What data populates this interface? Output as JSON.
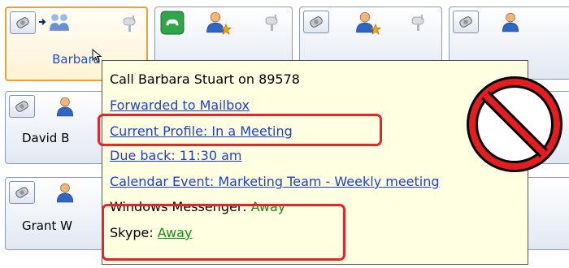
{
  "contacts": [
    {
      "name": "Barbara",
      "selected": true
    },
    {
      "name": "David B"
    },
    {
      "name": "Grant W"
    }
  ],
  "tooltip": {
    "title": "Call Barbara Stuart on 89578",
    "forwarded": "Forwarded to Mailbox",
    "profile": "Current Profile: In a Meeting",
    "due_back": "Due back: 11:30 am",
    "calendar": "Calendar Event: Marketing Team - Weekly meeting",
    "messenger_label": "Windows Messenger: ",
    "messenger_status": "Away",
    "skype_label": "Skype: ",
    "skype_status": "Away"
  },
  "colors": {
    "link": "#1c3fd8",
    "status_away": "#138f13",
    "highlight": "#e8242a",
    "selected_border": "#e6a33a"
  },
  "icons": [
    "phone-icon",
    "forward-arrow-icon",
    "group-icon",
    "mailbox-icon",
    "person-icon",
    "person-busy-icon",
    "call-active-icon",
    "no-entry-icon"
  ]
}
